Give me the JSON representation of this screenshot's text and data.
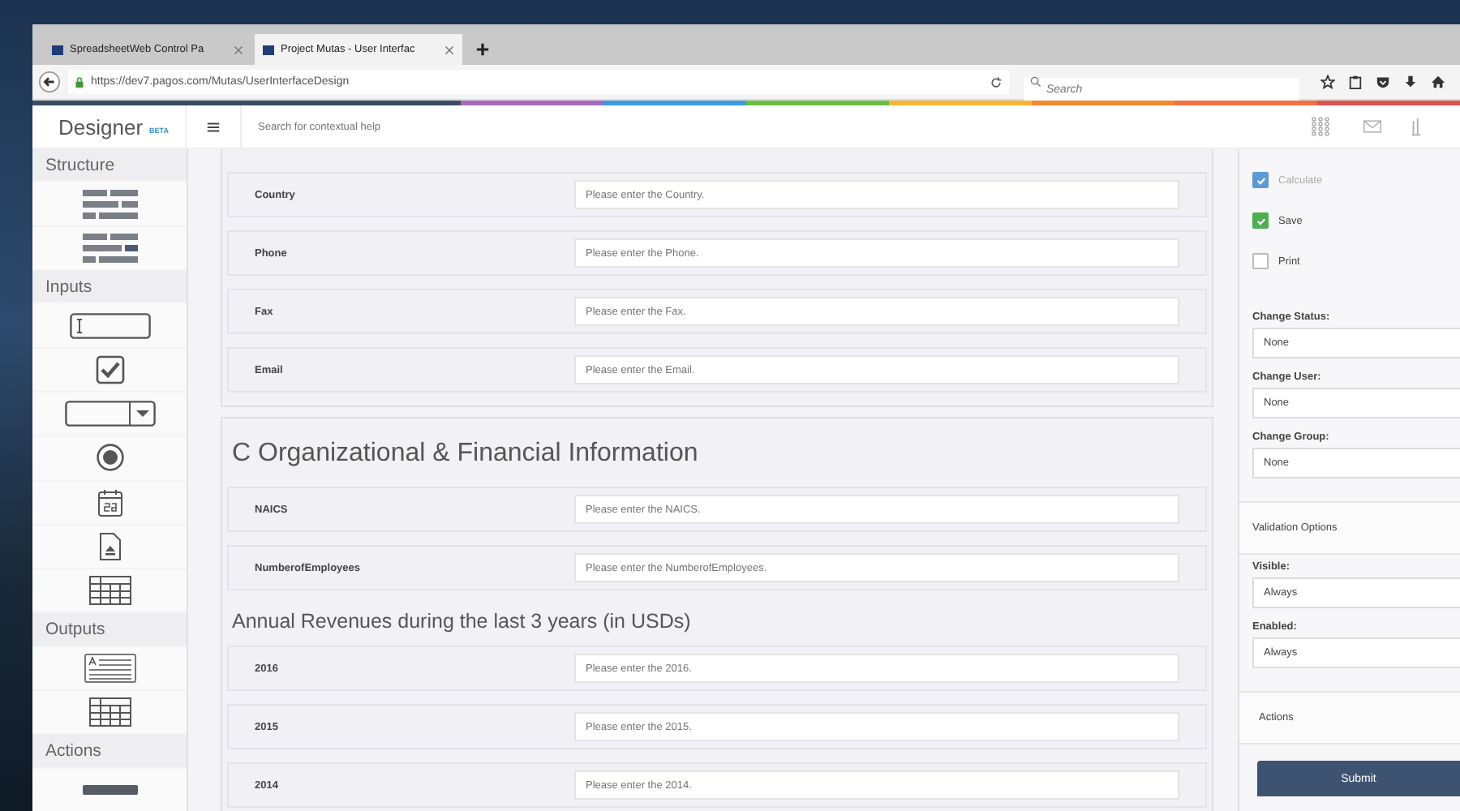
{
  "browser": {
    "tabs": [
      {
        "title": "SpreadsheetWeb Control Pa",
        "selected": false
      },
      {
        "title": "Project Mutas - User Interfac",
        "selected": true
      }
    ],
    "address": "https://dev7.pagos.com/Mutas/UserInterfaceDesign",
    "search": {
      "placeholder": "Search"
    }
  },
  "header": {
    "logo": "Designer",
    "badge": "BETA",
    "search": {
      "placeholder": "Search for contextual help"
    }
  },
  "sidebar": [
    {
      "title": "Structure",
      "tools": [
        {
          "kind": "layout-a"
        },
        {
          "kind": "layout-b"
        }
      ]
    },
    {
      "title": "Inputs",
      "tools": [
        {
          "kind": "textbox"
        },
        {
          "kind": "checkbox"
        },
        {
          "kind": "dropdown"
        },
        {
          "kind": "radio"
        },
        {
          "kind": "calendar"
        },
        {
          "kind": "file"
        },
        {
          "kind": "grid"
        }
      ]
    },
    {
      "title": "Outputs",
      "tools": [
        {
          "kind": "label"
        },
        {
          "kind": "table"
        }
      ]
    },
    {
      "title": "Actions",
      "tools": [
        {
          "kind": "button"
        }
      ]
    }
  ],
  "form": [
    {
      "rows": [
        {
          "label": "Country",
          "placeholder": "Please enter the Country."
        },
        {
          "label": "Phone",
          "placeholder": "Please enter the Phone."
        },
        {
          "label": "Fax",
          "placeholder": "Please enter the Fax."
        },
        {
          "label": "Email",
          "placeholder": "Please enter the Email."
        }
      ]
    },
    {
      "heading": "C Organizational & Financial Information",
      "blocks": [
        {
          "rows": [
            {
              "label": "NAICS",
              "placeholder": "Please enter the NAICS."
            },
            {
              "label": "NumberofEmployees",
              "placeholder": "Please enter the NumberofEmployees."
            }
          ]
        },
        {
          "subheading": "Annual Revenues during the last 3 years (in USDs)",
          "rows": [
            {
              "label": "2016",
              "placeholder": "Please enter the 2016."
            },
            {
              "label": "2015",
              "placeholder": "Please enter the 2015."
            },
            {
              "label": "2014",
              "placeholder": "Please enter the 2014."
            }
          ]
        }
      ]
    }
  ],
  "panel": {
    "checks": [
      {
        "label": "Calculate",
        "checked": true,
        "disabled": true,
        "color": "#5b9bd5"
      },
      {
        "label": "Save",
        "checked": true,
        "disabled": false,
        "color": "#4caf50"
      },
      {
        "label": "Print",
        "checked": false,
        "disabled": false
      }
    ],
    "selects": [
      {
        "label": "Change Status:",
        "value": "None"
      },
      {
        "label": "Change User:",
        "value": "None"
      },
      {
        "label": "Change Group:",
        "value": "None"
      }
    ],
    "validation": {
      "title": "Validation Options",
      "selects": [
        {
          "label": "Visible:",
          "value": "Always"
        },
        {
          "label": "Enabled:",
          "value": "Always"
        }
      ]
    },
    "actions": {
      "title": "Actions",
      "button": "Submit"
    }
  }
}
